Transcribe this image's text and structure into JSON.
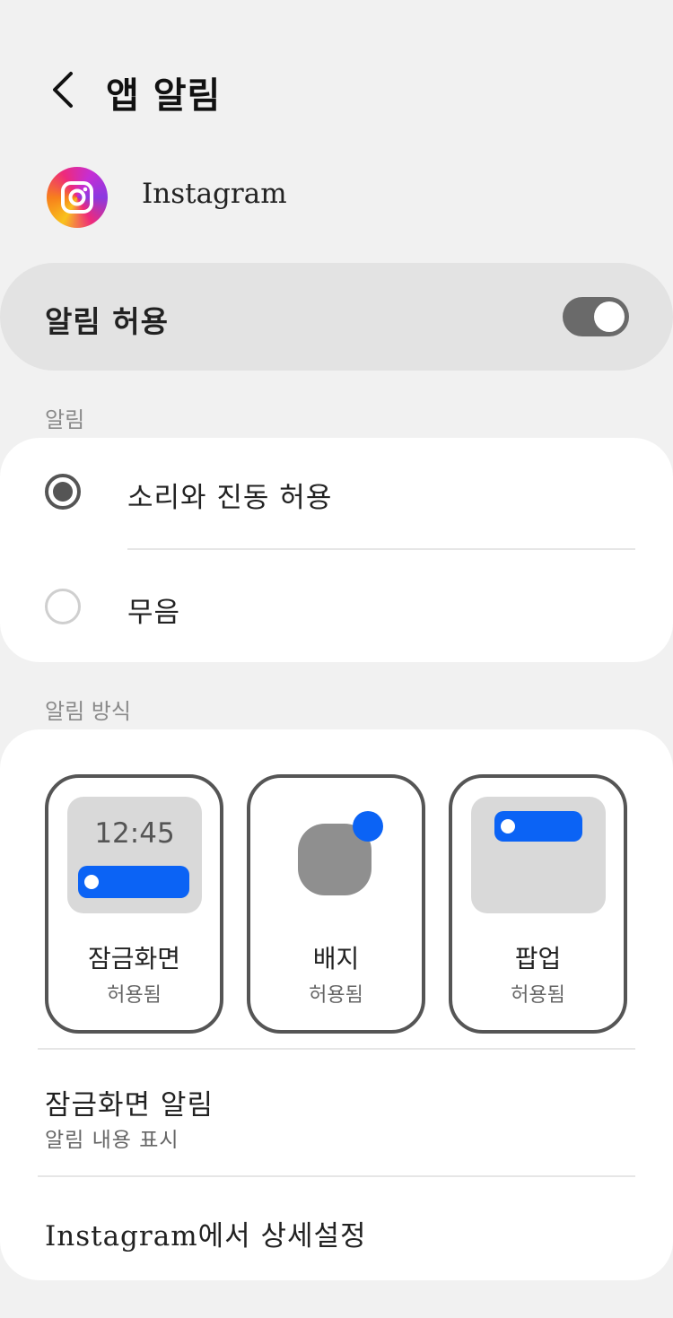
{
  "header": {
    "title": "앱 알림",
    "back_icon": "chevron-left-icon"
  },
  "app": {
    "name": "Instagram",
    "icon": "instagram-icon"
  },
  "allow": {
    "label": "알림 허용",
    "enabled": true
  },
  "alerts_section": {
    "label": "알림",
    "options": [
      {
        "label": "소리와 진동 허용",
        "selected": true
      },
      {
        "label": "무음",
        "selected": false
      }
    ]
  },
  "style_section": {
    "label": "알림 방식",
    "tiles": [
      {
        "label": "잠금화면",
        "status": "허용됨",
        "preview_time": "12:45"
      },
      {
        "label": "배지",
        "status": "허용됨"
      },
      {
        "label": "팝업",
        "status": "허용됨"
      }
    ],
    "lock_screen": {
      "title": "잠금화면 알림",
      "subtitle": "알림 내용 표시"
    },
    "advanced": {
      "title": "Instagram에서 상세설정"
    }
  },
  "colors": {
    "accent_blue": "#0b63f5",
    "toggle_track": "#6a6a6a",
    "background": "#f1f1f1"
  }
}
